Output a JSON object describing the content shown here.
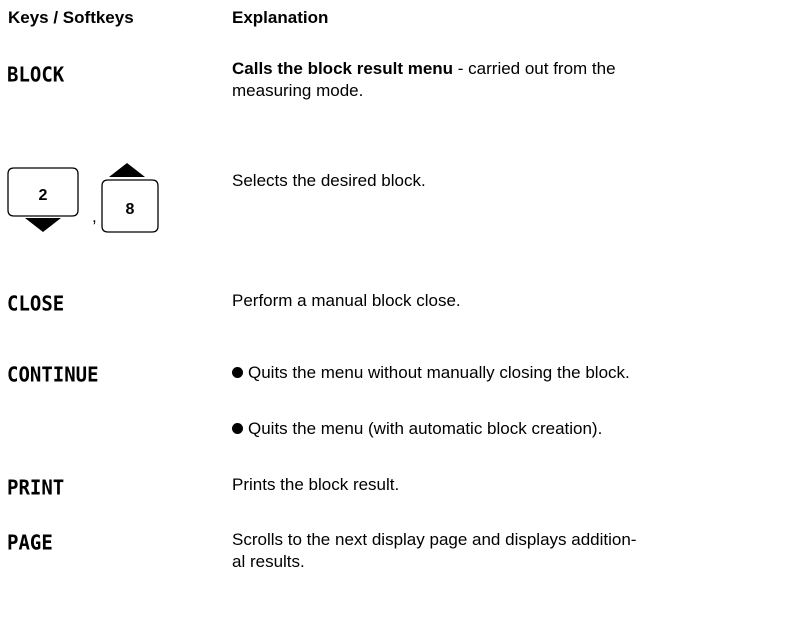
{
  "header": {
    "keys_label": "Keys / Softkeys",
    "explanation_label": "Explanation"
  },
  "rows": [
    {
      "key": "BLOCK",
      "explanation_bold": "Calls the block result menu",
      "explanation_rest": " - carried out from the",
      "explanation_line2": "measuring mode."
    },
    {
      "key_caps": [
        "2",
        "8"
      ],
      "key_separator": ",",
      "explanation": "Selects the desired block."
    },
    {
      "key": "CLOSE",
      "explanation": "Perform a manual block close."
    },
    {
      "key": "CONTINUE",
      "bullets": [
        "Quits the menu without manually closing the block.",
        "Quits the menu (with automatic block creation)."
      ]
    },
    {
      "key": "PRINT",
      "explanation": "Prints the block result."
    },
    {
      "key": "PAGE",
      "explanation_line1": "Scrolls to the next display page and displays addition-",
      "explanation_line2": "al results."
    }
  ]
}
